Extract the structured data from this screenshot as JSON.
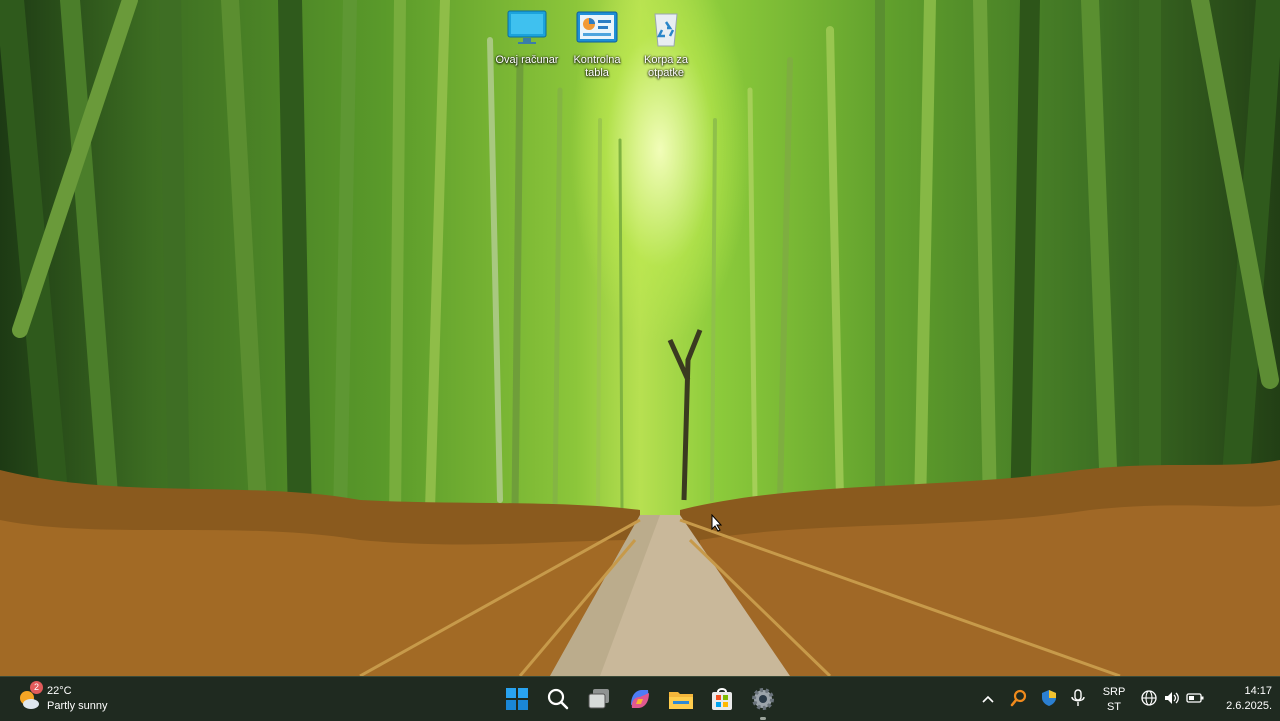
{
  "desktop": {
    "icons": [
      {
        "name": "this-pc",
        "label": "Ovaj računar",
        "icon": "monitor-icon"
      },
      {
        "name": "control-panel",
        "label": "Kontrolna tabla",
        "icon": "control-panel-icon"
      },
      {
        "name": "recycle-bin",
        "label": "Korpa za otpatke",
        "icon": "recycle-bin-icon"
      }
    ]
  },
  "taskbar": {
    "weather": {
      "temp": "22°C",
      "condition": "Partly sunny",
      "badge": "2",
      "icon": "partly-sunny-icon"
    },
    "apps": [
      {
        "name": "start-button",
        "icon": "windows-logo-icon"
      },
      {
        "name": "search-button",
        "icon": "search-icon"
      },
      {
        "name": "task-view-button",
        "icon": "task-view-icon"
      },
      {
        "name": "copilot-button",
        "icon": "copilot-icon"
      },
      {
        "name": "file-explorer-button",
        "icon": "folder-icon"
      },
      {
        "name": "store-button",
        "icon": "store-icon"
      },
      {
        "name": "settings-button",
        "icon": "gear-icon"
      }
    ],
    "tray": {
      "language": {
        "line1": "SRP",
        "line2": "ST"
      },
      "clock": {
        "time": "14:17",
        "date": "2.6.2025."
      }
    }
  },
  "colors": {
    "taskbar": "#1f2a20",
    "accent": "#0078d4"
  }
}
